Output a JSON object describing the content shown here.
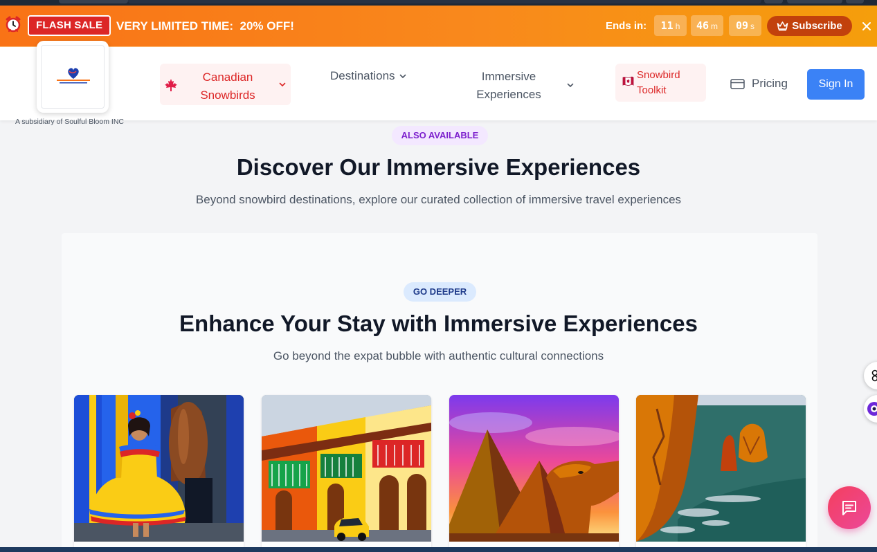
{
  "flash_bar": {
    "badge": "FLASH SALE",
    "message": "VERY LIMITED TIME:  20% OFF!",
    "ends_label": "Ends in:",
    "hours": "11",
    "hours_unit": "h",
    "minutes": "46",
    "minutes_unit": "m",
    "seconds": "09",
    "seconds_unit": "s",
    "subscribe_label": "Subscribe",
    "background_color": "#f97316"
  },
  "header": {
    "logo_alt": "Soulful Bloom logo",
    "subsidiary_text": "A subsidiary of Soulful Bloom INC",
    "nav": {
      "canadian_snowbirds": "Canadian Snowbirds",
      "destinations": "Destinations",
      "immersive_experiences": "Immersive Experiences",
      "snowbird_toolkit": "Snowbird Toolkit",
      "pricing": "Pricing"
    },
    "sign_in_label": "Sign In",
    "accent_color": "#3b82f6"
  },
  "intro": {
    "badge": "ALSO AVAILABLE",
    "title": "Discover Our Immersive Experiences",
    "subtitle": "Beyond snowbird destinations, explore our curated collection of immersive travel experiences"
  },
  "experiences_section": {
    "badge": "GO DEEPER",
    "title": "Enhance Your Stay with Immersive Experiences",
    "subtitle": "Go beyond the expat bubble with authentic cultural connections",
    "cards": [
      {
        "image_icon": "colombian-dancer-photo"
      },
      {
        "image_icon": "colonial-street-photo"
      },
      {
        "image_icon": "pyramids-camel-photo"
      },
      {
        "image_icon": "coastal-cliffs-photo"
      }
    ]
  },
  "icons": {
    "flash": "alarm-clock-icon",
    "subscribe": "crown-icon",
    "close": "close-icon",
    "maple": "maple-leaf-icon",
    "toolkit": "canada-flag-icon",
    "pricing": "credit-card-icon",
    "chat": "chat-bubble-icon"
  }
}
